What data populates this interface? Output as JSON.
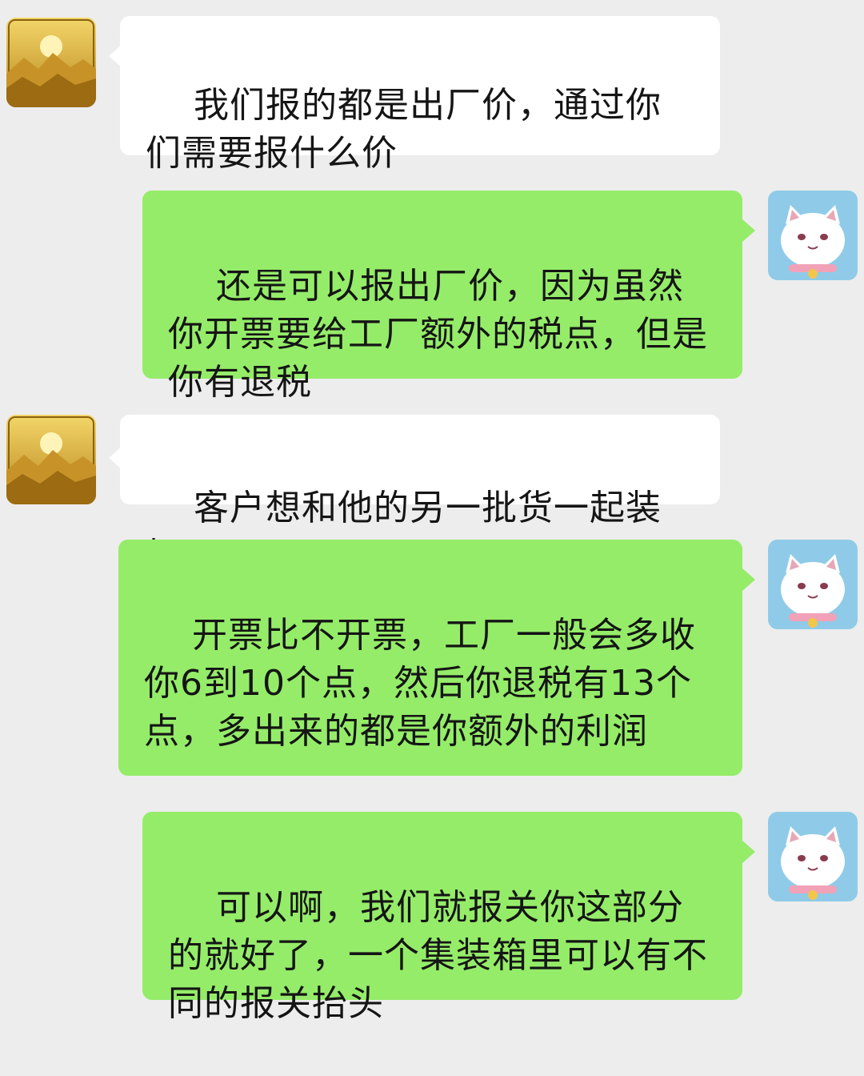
{
  "messages": [
    {
      "side": "left",
      "avatar": "golden-mountain-avatar",
      "text": "我们报的都是出厂价，通过你们需要报什么价"
    },
    {
      "side": "right",
      "avatar": "white-cat-avatar",
      "text": "还是可以报出厂价，因为虽然你开票要给工厂额外的税点，但是你有退税"
    },
    {
      "side": "left",
      "avatar": "golden-mountain-avatar",
      "text": "客户想和他的另一批货一起装柜"
    },
    {
      "side": "right",
      "avatar": "white-cat-avatar",
      "text": "开票比不开票，工厂一般会多收你6到10个点，然后你退税有13个点，多出来的都是你额外的利润"
    },
    {
      "side": "right",
      "avatar": "white-cat-avatar",
      "text": "可以啊，我们就报关你这部分的就好了，一个集装箱里可以有不同的报关抬头"
    }
  ],
  "colors": {
    "background": "#ededed",
    "incoming_bubble": "#ffffff",
    "outgoing_bubble": "#95ec69"
  }
}
